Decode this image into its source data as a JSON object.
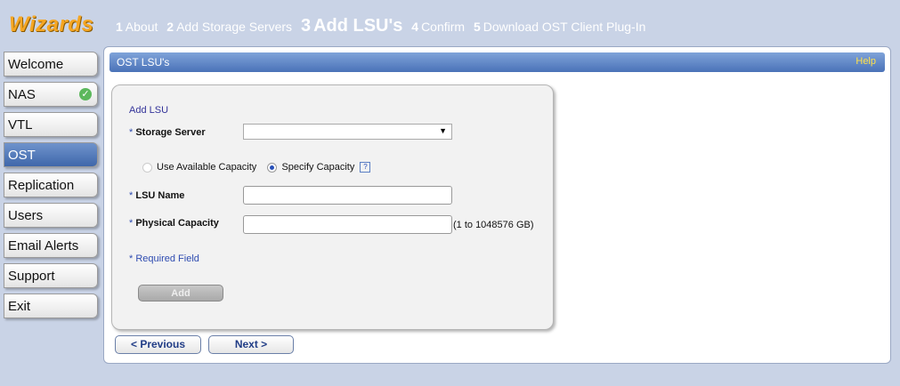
{
  "brand": "Wizards",
  "steps": [
    {
      "num": "1",
      "label": "About",
      "active": false
    },
    {
      "num": "2",
      "label": "Add Storage Servers",
      "active": false
    },
    {
      "num": "3",
      "label": "Add LSU's",
      "active": true
    },
    {
      "num": "4",
      "label": "Confirm",
      "active": false
    },
    {
      "num": "5",
      "label": "Download OST Client Plug-In",
      "active": false
    }
  ],
  "sidebar": {
    "items": [
      {
        "label": "Welcome"
      },
      {
        "label": "NAS",
        "status": "check"
      },
      {
        "label": "VTL"
      },
      {
        "label": "OST",
        "active": true
      },
      {
        "label": "Replication"
      },
      {
        "label": "Users"
      },
      {
        "label": "Email Alerts"
      },
      {
        "label": "Support"
      },
      {
        "label": "Exit"
      }
    ]
  },
  "panel": {
    "title": "OST LSU's",
    "help": "Help",
    "section": "Add LSU",
    "storage_server_label": "Storage Server",
    "storage_server_value": "",
    "required_mark": "*",
    "radio_available": "Use Available Capacity",
    "radio_specify": "Specify Capacity",
    "help_glyph": "?",
    "lsu_name_label": "LSU Name",
    "lsu_name_value": "",
    "physical_capacity_label": "Physical Capacity",
    "physical_capacity_value": "",
    "capacity_hint": "(1 to 1048576 GB)",
    "required_note": "* Required Field",
    "add_button": "Add"
  },
  "nav": {
    "previous": "< Previous",
    "next": "Next >"
  },
  "colors": {
    "background": "#c9d3e6",
    "brand": "#f5a623",
    "titlebar": "#4a72b8",
    "active_nav": "#3f67aa",
    "help": "#ffe14a"
  }
}
